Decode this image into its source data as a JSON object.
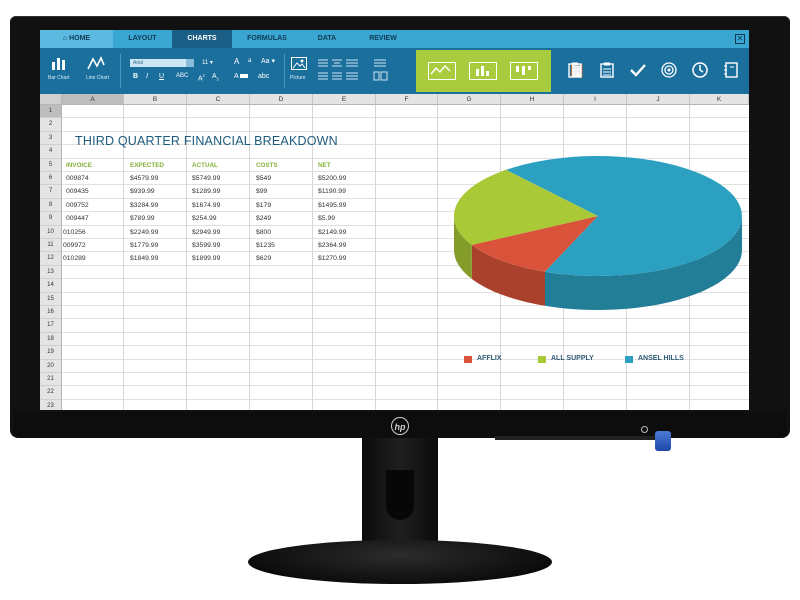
{
  "device": {
    "logo": "hp"
  },
  "tabs": [
    {
      "label": "HOME",
      "icon": "home-icon"
    },
    {
      "label": "LAYOUT"
    },
    {
      "label": "CHARTS",
      "active": true
    },
    {
      "label": "FORMULAS"
    },
    {
      "label": "DATA"
    },
    {
      "label": "REVIEW"
    }
  ],
  "window": {
    "close_label": "✕"
  },
  "ribbon": {
    "bar_chart_label": "Bar Chart",
    "line_chart_label": "Line Chart",
    "font_name": "Arial",
    "font_size": "11",
    "bold": "B",
    "italic": "I",
    "underline": "U",
    "strikethrough": "ABC",
    "superscript": "A",
    "subscript": "A",
    "font_grow": "A",
    "font_shrink": "a",
    "change_case": "Aa",
    "highlight": "A",
    "lowercase": "abc",
    "picture_label": "Picture"
  },
  "sheet": {
    "columns": [
      "A",
      "B",
      "C",
      "D",
      "E",
      "F",
      "G",
      "H",
      "I",
      "J",
      "K"
    ],
    "selected_column": "A",
    "rows": [
      "1",
      "2",
      "3",
      "4",
      "5",
      "6",
      "7",
      "8",
      "9",
      "10",
      "11",
      "12",
      "13",
      "14",
      "15",
      "16",
      "17",
      "18",
      "19",
      "20",
      "21",
      "22",
      "23"
    ],
    "selected_row": "1",
    "title": "THIRD QUARTER FINANCIAL BREAKDOWN",
    "headers": [
      "INVOICE",
      "EXPECTED",
      "ACTUAL",
      "COSTS",
      "NET"
    ],
    "data": [
      [
        "009874",
        "$4579.99",
        "$5749.99",
        "$549",
        "$5200.99"
      ],
      [
        "009435",
        "$939.99",
        "$1289.99",
        "$99",
        "$1190.99"
      ],
      [
        "009752",
        "$3284.99",
        "$1674.99",
        "$179",
        "$1495.99"
      ],
      [
        "009447",
        "$789.99",
        "$254.99",
        "$249",
        "$5.99"
      ],
      [
        "010256",
        "$2249.99",
        "$2949.99",
        "$800",
        "$2149.99"
      ],
      [
        "009972",
        "$1779.99",
        "$3599.99",
        "$1235",
        "$2364.99"
      ],
      [
        "010289",
        "$1849.99",
        "$1899.99",
        "$629",
        "$1270.99"
      ]
    ]
  },
  "chart_data": {
    "type": "pie",
    "categories": [
      "AFFLIX",
      "ALL SUPPLY",
      "ANSEL HILLS"
    ],
    "values": [
      11,
      22,
      67
    ],
    "colors": [
      "#d9533a",
      "#a9c936",
      "#2ba0c1"
    ],
    "legend_position": "bottom",
    "three_d": true
  }
}
